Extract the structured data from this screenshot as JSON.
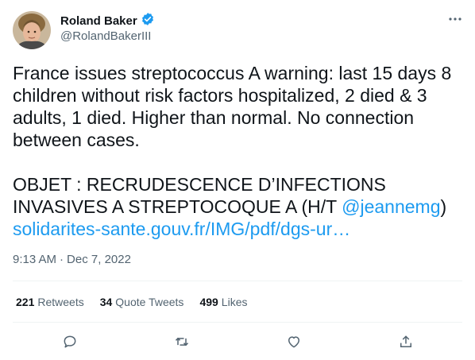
{
  "author": {
    "display_name": "Roland Baker",
    "handle": "@RolandBakerIII",
    "verified_icon": "verified-badge-icon",
    "badge_color": "#1d9bf0"
  },
  "tweet": {
    "paragraph1": "France issues streptococcus A warning: last 15 days 8 children without risk factors hospitalized, 2 died & 3 adults, 1 died. Higher than normal. No connection between cases.",
    "paragraph2_lead": "OBJET : RECRUDESCENCE D’INFECTIONS INVASIVES A STREPTOCOQUE A (H/T ",
    "mention": "@jeannemg",
    "paragraph2_tail": ")",
    "url": "solidarites-sante.gouv.fr/IMG/pdf/dgs-ur…",
    "link_color": "#1d9bf0"
  },
  "meta": {
    "time": "9:13 AM",
    "separator": "·",
    "date": "Dec 7, 2022"
  },
  "stats": {
    "retweets_count": "221",
    "retweets_label": "Retweets",
    "quotes_count": "34",
    "quotes_label": "Quote Tweets",
    "likes_count": "499",
    "likes_label": "Likes"
  },
  "icons": [
    "more-icon",
    "reply-icon",
    "retweet-icon",
    "like-icon",
    "share-icon"
  ]
}
